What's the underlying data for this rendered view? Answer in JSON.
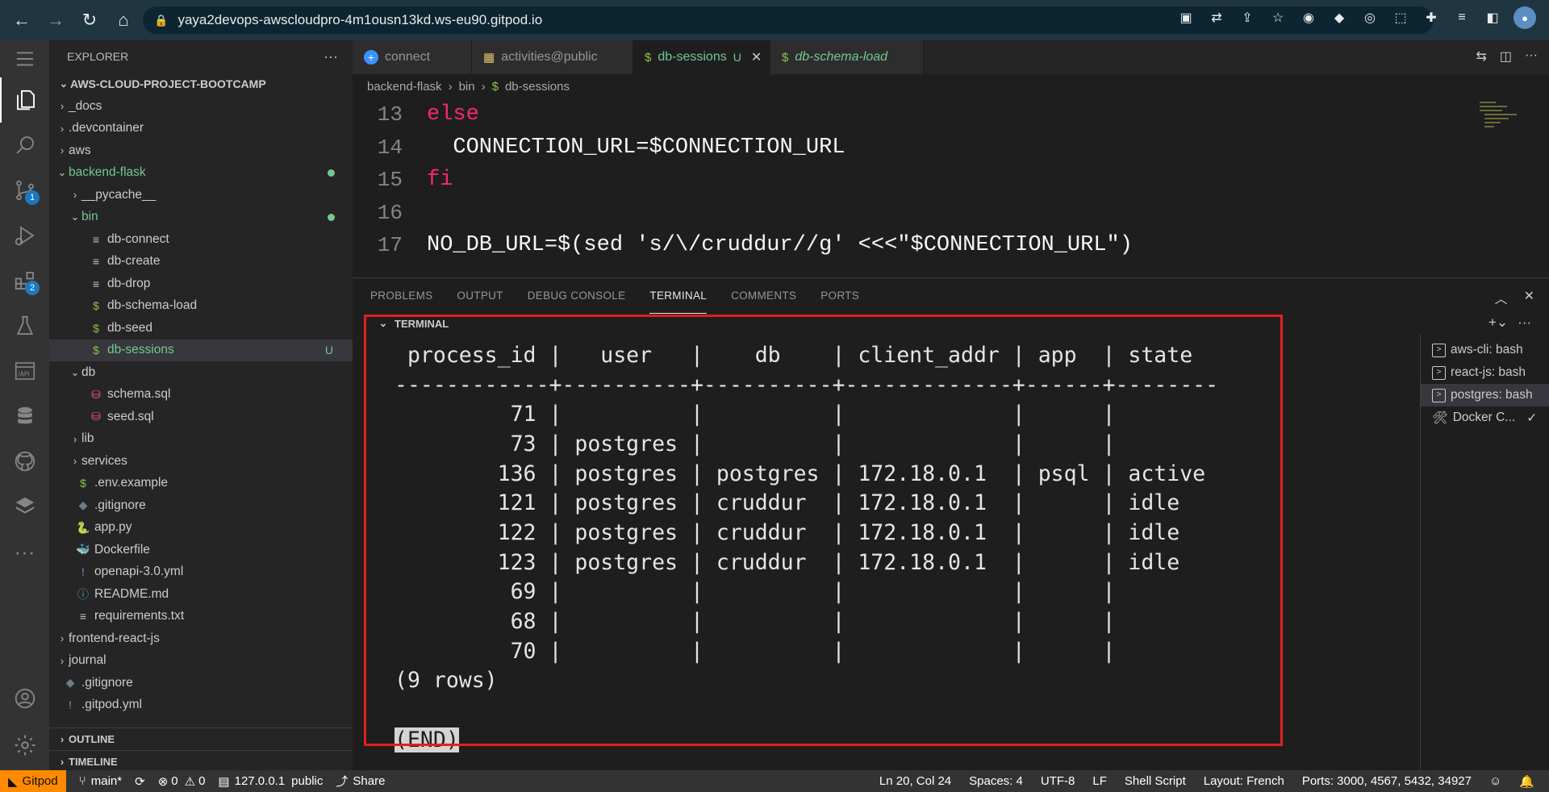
{
  "browser": {
    "url": "yaya2devops-awscloudpro-4m1ousn13kd.ws-eu90.gitpod.io"
  },
  "activity_bar": {
    "source_control_badge": "1",
    "extensions_badge": "2"
  },
  "sidebar": {
    "title": "EXPLORER",
    "project": "AWS-CLOUD-PROJECT-BOOTCAMP",
    "tree": [
      {
        "label": "_docs",
        "type": "folder",
        "open": false,
        "depth": 1
      },
      {
        "label": ".devcontainer",
        "type": "folder",
        "open": false,
        "depth": 1
      },
      {
        "label": "aws",
        "type": "folder",
        "open": false,
        "depth": 1
      },
      {
        "label": "backend-flask",
        "type": "folder",
        "open": true,
        "depth": 1,
        "dot": true,
        "green": true
      },
      {
        "label": "__pycache__",
        "type": "folder",
        "open": false,
        "depth": 2
      },
      {
        "label": "bin",
        "type": "folder",
        "open": true,
        "depth": 2,
        "dot": true,
        "green": true
      },
      {
        "label": "db-connect",
        "type": "file",
        "icon": "lines",
        "depth": 3
      },
      {
        "label": "db-create",
        "type": "file",
        "icon": "lines",
        "depth": 3
      },
      {
        "label": "db-drop",
        "type": "file",
        "icon": "lines",
        "depth": 3
      },
      {
        "label": "db-schema-load",
        "type": "file",
        "icon": "dollar",
        "depth": 3
      },
      {
        "label": "db-seed",
        "type": "file",
        "icon": "dollar",
        "depth": 3
      },
      {
        "label": "db-sessions",
        "type": "file",
        "icon": "dollar",
        "depth": 3,
        "selected": true,
        "status": "U",
        "green": true
      },
      {
        "label": "db",
        "type": "folder",
        "open": true,
        "depth": 2
      },
      {
        "label": "schema.sql",
        "type": "file",
        "icon": "db",
        "depth": 3
      },
      {
        "label": "seed.sql",
        "type": "file",
        "icon": "db",
        "depth": 3
      },
      {
        "label": "lib",
        "type": "folder",
        "open": false,
        "depth": 2
      },
      {
        "label": "services",
        "type": "folder",
        "open": false,
        "depth": 2
      },
      {
        "label": ".env.example",
        "type": "file",
        "icon": "dollar",
        "depth": 2
      },
      {
        "label": ".gitignore",
        "type": "file",
        "icon": "diamond",
        "depth": 2
      },
      {
        "label": "app.py",
        "type": "file",
        "icon": "python",
        "depth": 2
      },
      {
        "label": "Dockerfile",
        "type": "file",
        "icon": "docker",
        "depth": 2
      },
      {
        "label": "openapi-3.0.yml",
        "type": "file",
        "icon": "excl",
        "depth": 2
      },
      {
        "label": "README.md",
        "type": "file",
        "icon": "info",
        "depth": 2
      },
      {
        "label": "requirements.txt",
        "type": "file",
        "icon": "lines",
        "depth": 2
      },
      {
        "label": "frontend-react-js",
        "type": "folder",
        "open": false,
        "depth": 1
      },
      {
        "label": "journal",
        "type": "folder",
        "open": false,
        "depth": 1
      },
      {
        "label": ".gitignore",
        "type": "file",
        "icon": "diamond",
        "depth": 1
      },
      {
        "label": ".gitpod.yml",
        "type": "file",
        "icon": "excl",
        "depth": 1
      }
    ],
    "outline": "OUTLINE",
    "timeline": "TIMELINE"
  },
  "tabs": [
    {
      "label": "connect",
      "icon": "plus-circle",
      "active": false
    },
    {
      "label": "activities@public",
      "icon": "table",
      "active": false
    },
    {
      "label": "db-sessions",
      "icon": "dollar",
      "active": true,
      "status": "U"
    },
    {
      "label": "db-schema-load",
      "icon": "dollar",
      "active": false,
      "italic": true
    }
  ],
  "breadcrumb": [
    "backend-flask",
    "bin",
    "db-sessions"
  ],
  "editor": {
    "lines": [
      {
        "n": "13",
        "kw": "else",
        "rest": ""
      },
      {
        "n": "14",
        "kw": "",
        "rest": "  CONNECTION_URL=$CONNECTION_URL"
      },
      {
        "n": "15",
        "kw": "fi",
        "rest": ""
      },
      {
        "n": "16",
        "kw": "",
        "rest": ""
      },
      {
        "n": "17",
        "kw": "",
        "rest": "NO_DB_URL=$(sed 's/\\/cruddur//g' <<<\"$CONNECTION_URL\")"
      }
    ]
  },
  "panel": {
    "tabs": [
      "PROBLEMS",
      "OUTPUT",
      "DEBUG CONSOLE",
      "TERMINAL",
      "COMMENTS",
      "PORTS"
    ],
    "active_tab": "TERMINAL",
    "terminal_header": "TERMINAL",
    "terminal_lines": [
      " process_id |   user   |    db    | client_addr | app  | state",
      "------------+----------+----------+-------------+------+--------",
      "         71 |          |          |             |      |",
      "         73 | postgres |          |             |      |",
      "        136 | postgres | postgres | 172.18.0.1  | psql | active",
      "        121 | postgres | cruddur  | 172.18.0.1  |      | idle",
      "        122 | postgres | cruddur  | 172.18.0.1  |      | idle",
      "        123 | postgres | cruddur  | 172.18.0.1  |      | idle",
      "         69 |          |          |             |      |",
      "         68 |          |          |             |      |",
      "         70 |          |          |             |      |",
      "(9 rows)",
      "",
      "(END)"
    ],
    "terminal_list": [
      {
        "label": "aws-cli: bash",
        "active": false
      },
      {
        "label": "react-js: bash",
        "active": false
      },
      {
        "label": "postgres: bash",
        "active": true
      },
      {
        "label": "Docker C...",
        "active": false,
        "icon": "tools",
        "check": true
      }
    ]
  },
  "statusbar": {
    "gitpod": "Gitpod",
    "branch": "main*",
    "errors": "0",
    "warnings": "0",
    "db": "127.0.0.1",
    "schema": "public",
    "share": "Share",
    "position": "Ln 20, Col 24",
    "spaces": "Spaces: 4",
    "encoding": "UTF-8",
    "eol": "LF",
    "language": "Shell Script",
    "layout": "Layout: French",
    "ports": "Ports: 3000, 4567, 5432, 34927"
  },
  "colors": {
    "accent_green": "#73c991",
    "gitpod_orange": "#ff8a00",
    "highlight_red": "#e02020",
    "keyword_pink": "#f92672",
    "string_yellow": "#e6db74"
  }
}
